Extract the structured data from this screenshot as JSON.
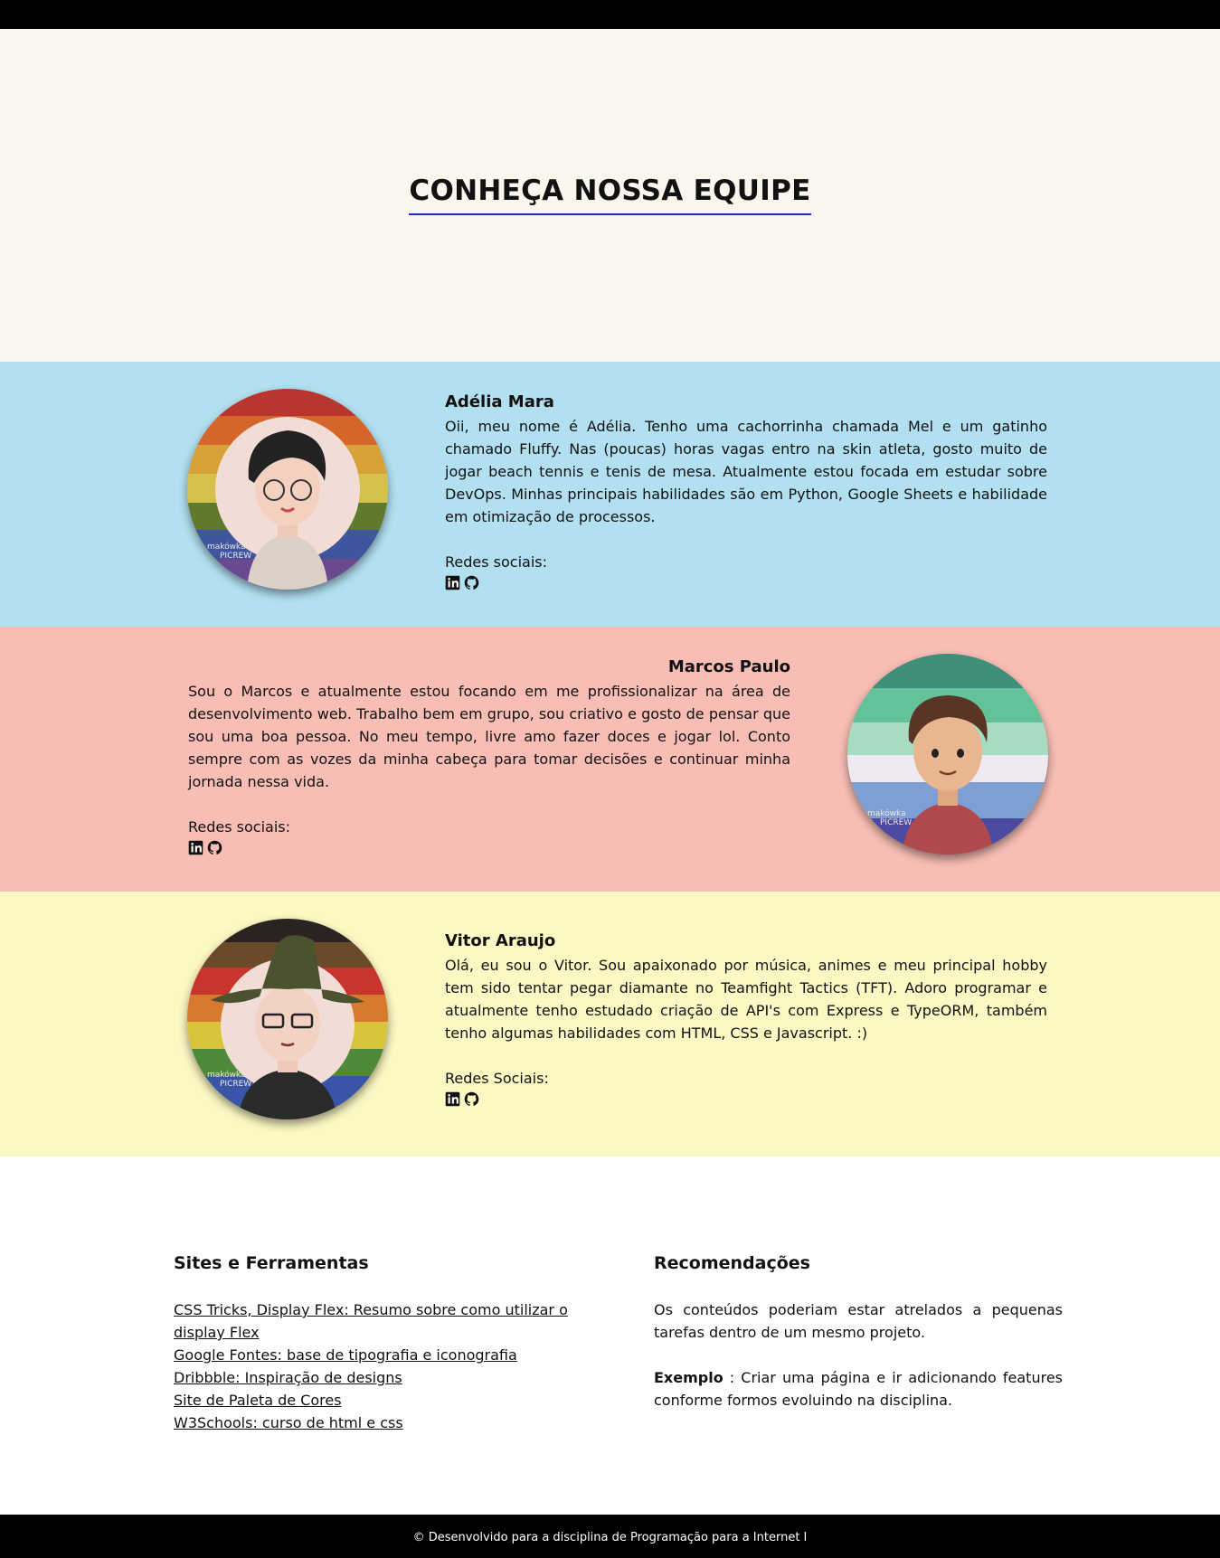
{
  "page": {
    "title": "CONHEÇA NOSSA EQUIPE"
  },
  "members": [
    {
      "name": "Adélia Mara",
      "bio": "Oii, meu nome é Adélia. Tenho uma cachorrinha chamada Mel e um gatinho chamado Fluffy. Nas (poucas) horas vagas entro na skin atleta, gosto muito de jogar beach tennis e tenis de mesa. Atualmente estou focada em estudar sobre DevOps. Minhas principais habilidades são em Python, Google Sheets e habilidade em otimização de processos.",
      "social_label": "Redes sociais:",
      "bg_color": "#b2e0f0",
      "icons": [
        "linkedin-icon",
        "github-icon"
      ]
    },
    {
      "name": "Marcos Paulo",
      "bio": "Sou o Marcos e atualmente estou focando em me profissionalizar na área de desenvolvimento web. Trabalho bem em grupo, sou criativo e gosto de pensar que sou uma boa pessoa. No meu tempo, livre amo fazer doces e jogar lol. Conto sempre com as vozes da minha cabeça para tomar decisões e continuar minha jornada nessa vida.",
      "social_label": "Redes sociais:",
      "bg_color": "#f8beb5",
      "icons": [
        "linkedin-icon",
        "github-icon"
      ]
    },
    {
      "name": "Vitor Araujo",
      "bio": "Olá, eu sou o Vitor. Sou apaixonado por música, animes e meu principal hobby tem sido tentar pegar diamante no Teamfight Tactics (TFT). Adoro programar e atualmente tenho estudado criação de API's com Express e TypeORM, também tenho algumas habilidades com HTML, CSS e Javascript. :)",
      "social_label": "Redes Sociais:",
      "bg_color": "#fcf8c3",
      "icons": [
        "linkedin-icon",
        "github-icon"
      ]
    }
  ],
  "avatar_watermark": [
    "makówka",
    "PICREW"
  ],
  "resources": {
    "sites_title": "Sites e Ferramentas",
    "links": [
      "CSS Tricks, Display Flex: Resumo sobre como utilizar o display Flex",
      "Google Fontes: base de tipografia e iconografia",
      "Dribbble: Inspiração de designs",
      "Site de Paleta de Cores",
      "W3Schools: curso de html e css"
    ],
    "recommendations_title": "Recomendações",
    "recommendation_text": "Os conteúdos poderiam estar atrelados a pequenas tarefas dentro de um mesmo projeto.",
    "example_label": "Exemplo",
    "example_text": " : Criar uma página e ir adicionando features conforme formos evoluindo na disciplina."
  },
  "footer": {
    "text": "© Desenvolvido para a disciplina de Programação para a Internet I"
  },
  "colors": {
    "accent_underline": "#2a22d6",
    "hero_bg": "#f9f6ee",
    "bars": "#000000"
  }
}
